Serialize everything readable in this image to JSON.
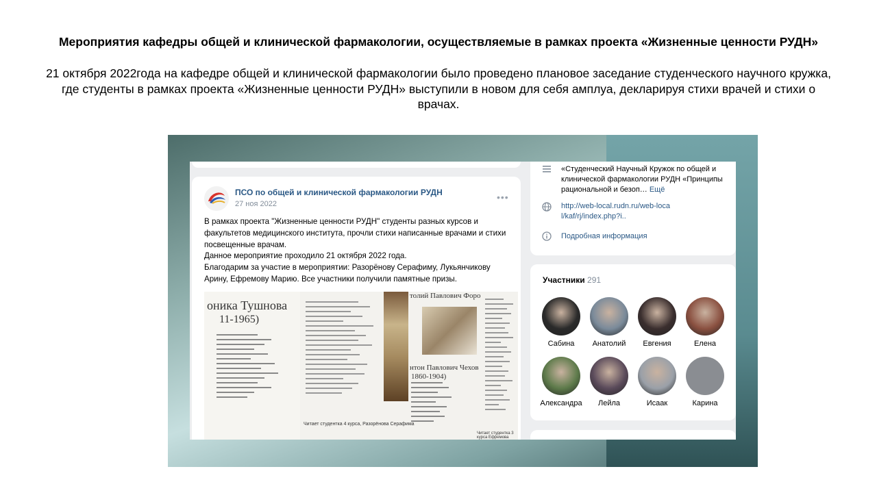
{
  "slide": {
    "title": "Мероприятия кафедры общей и клинической фармакологии, осуществляемые в рамках проекта «Жизненные ценности РУДН»",
    "text": "21 октября 2022года на кафедре общей и клинической фармакологии было проведено плановое заседание студенческого научного кружка, где студенты в рамках проекта «Жизненные ценности РУДН» выступили в новом для себя амплуа, декларируя стихи врачей и стихи о врачах."
  },
  "post": {
    "author": "ПСО по общей и клинической фармакологии РУДН",
    "date": "27 ноя 2022",
    "menu_icon": "•••",
    "text_lines": [
      "В рамках проекта \"Жизненные ценности РУДН\" студенты разных курсов и",
      "факультетов медицинского института, прочли стихи написанные врачами и стихи",
      "посвещенные врачам.",
      "Данное мероприятие проходило 21 октября 2022 года.",
      "Благодарим за участие в мероприятии: Разорёнову Серафиму, Лукьянчикову",
      "Арину, Ефремову Марию. Все участники получили памятные призы."
    ],
    "image": {
      "poet1_name": "оника Тушнова",
      "poet1_years": "11-1965)",
      "poet2_name": "толий Павлович Форо",
      "poet3_name": "нтон Павлович Чехов",
      "poet3_years": "1860-1904)",
      "caption1": "Читает студентка 4 курса, Разорёнова Серафима",
      "caption2": "Читает студентка 3 курса Ефремова"
    }
  },
  "group_info": {
    "description": "«Студенческий Научный Кружок по общей и клинической фармакологии РУДН «Принципы рациональной и безоп…",
    "more_label": "Ещё",
    "link": "http://web-local.rudn.ru/web-local/kaf/rj/index.php?i..",
    "details_label": "Подробная информация",
    "icons": [
      "menu-lines-icon",
      "globe-icon",
      "info-icon"
    ]
  },
  "members": {
    "title": "Участники",
    "count": "291",
    "list": [
      {
        "name": "Сабина",
        "color": "#2a2a2a"
      },
      {
        "name": "Анатолий",
        "color": "#7a8a9a"
      },
      {
        "name": "Евгения",
        "color": "#3a2e2e"
      },
      {
        "name": "Елена",
        "color": "#8a5040"
      },
      {
        "name": "Александра",
        "color": "#5d7a4a"
      },
      {
        "name": "Лейла",
        "color": "#5a4a5a"
      },
      {
        "name": "Исаак",
        "color": "#9aa0a8"
      },
      {
        "name": "Карина",
        "color": "#8a8d92"
      }
    ]
  },
  "colors": {
    "link": "#2a5885",
    "secondary": "#818c99",
    "background": "#edeef0"
  }
}
